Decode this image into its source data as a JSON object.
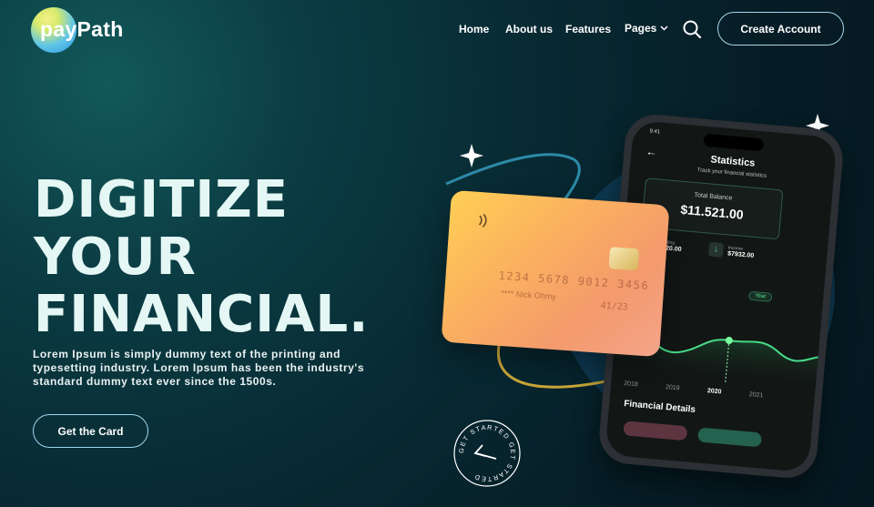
{
  "brand": {
    "name": "payPath"
  },
  "nav": {
    "home": "Home",
    "about": "About us",
    "features": "Features",
    "pages": "Pages"
  },
  "header": {
    "create_account": "Create Account",
    "search_icon": "search-icon"
  },
  "hero": {
    "title_line1": "DIGITIZE",
    "title_line2": "YOUR",
    "title_line3": "FINANCIAL.",
    "description": "Lorem Ipsum is simply dummy text of the printing and typesetting industry. Lorem Ipsum has been the industry's standard dummy text ever since the 1500s.",
    "cta": "Get the Card"
  },
  "card": {
    "number": "1234 5678 9012 3456",
    "holder": "Nick Ohmy",
    "dots": "****",
    "expiry": "41/23"
  },
  "phone": {
    "time": "9:41",
    "title": "Statistics",
    "subtitle": "Track your financial statistics",
    "balance_label": "Total Balance",
    "balance_value": "$11.521.00",
    "spending_label": "Spending",
    "spending_value": "$3120.00",
    "income_label": "Income",
    "income_value": "$7932.00",
    "period": "Year",
    "years": [
      "2018",
      "2019",
      "2020",
      "2021"
    ],
    "section": "Financial Details"
  },
  "badge": {
    "text": "GET STARTED GET STARTED"
  },
  "colors": {
    "accent_yellow": "#ffcf55",
    "accent_green": "#49d282",
    "outline": "#9fd6ec"
  }
}
